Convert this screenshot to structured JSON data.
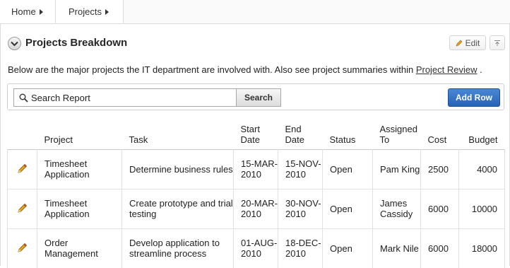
{
  "breadcrumb": {
    "home": "Home",
    "projects": "Projects"
  },
  "region": {
    "title": "Projects Breakdown",
    "edit_label": "Edit",
    "description_prefix": "Below are the major projects the IT department are involved with. Also see project summaries within ",
    "description_link": "Project Review",
    "description_suffix": " ."
  },
  "search": {
    "placeholder": "Search Report",
    "button_label": "Search",
    "add_row_label": "Add Row"
  },
  "table": {
    "columns": {
      "project": "Project",
      "task": "Task",
      "start_date": "Start Date",
      "end_date": "End Date",
      "status": "Status",
      "assigned_to": "Assigned To",
      "cost": "Cost",
      "budget": "Budget"
    },
    "rows": [
      {
        "project": "Timesheet Application",
        "task": "Determine business rules",
        "start_date": "15-MAR-2010",
        "end_date": "15-NOV-2010",
        "status": "Open",
        "assigned_to": "Pam King",
        "cost": "2500",
        "budget": "4000"
      },
      {
        "project": "Timesheet Application",
        "task": "Create prototype and trial testing",
        "start_date": "20-MAR-2010",
        "end_date": "30-NOV-2010",
        "status": "Open",
        "assigned_to": "James Cassidy",
        "cost": "6000",
        "budget": "10000"
      },
      {
        "project": "Order Management",
        "task": "Develop application to streamline process",
        "start_date": "01-AUG-2010",
        "end_date": "18-DEC-2010",
        "status": "Open",
        "assigned_to": "Mark Nile",
        "cost": "6000",
        "budget": "18000"
      }
    ]
  },
  "colors": {
    "accent": "#2763b6",
    "pencil": "#e8a317"
  }
}
